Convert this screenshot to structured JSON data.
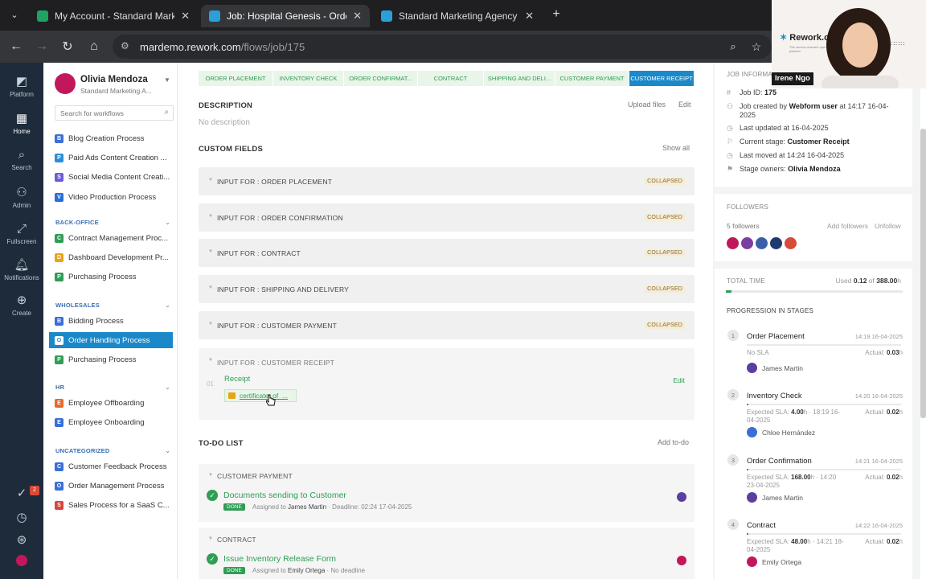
{
  "browser": {
    "tabs": [
      {
        "title": "My Account - Standard Marketi",
        "color": "#1ea362"
      },
      {
        "title": "Job: Hospital Genesis - Order H",
        "color": "#2a9fd8"
      },
      {
        "title": "Standard Marketing Agency",
        "color": "#2a9fd8"
      }
    ],
    "close_glyph": "✕",
    "new_tab_glyph": "+",
    "url_host": "mardemo.rework.com",
    "url_path": "/flows/job/175"
  },
  "rail": [
    {
      "label": "Platform",
      "icon": "platform-icon"
    },
    {
      "label": "Home",
      "icon": "home-icon"
    },
    {
      "label": "Search",
      "icon": "search-icon"
    },
    {
      "label": "Admin",
      "icon": "admin-icon"
    },
    {
      "label": "Fullscreen",
      "icon": "fullscreen-icon"
    },
    {
      "label": "Notifications",
      "icon": "bell-icon"
    },
    {
      "label": "Create",
      "icon": "plus-icon"
    }
  ],
  "rail_badge": "2",
  "sidebar": {
    "user_name": "Olivia Mendoza",
    "org_name": "Standard Marketing A...",
    "search_placeholder": "Search for workflows",
    "groups": [
      {
        "title": "",
        "items": [
          {
            "label": "Blog Creation Process",
            "color": "#3a6fd8",
            "glyph": "B"
          },
          {
            "label": "Paid Ads Content Creation ...",
            "color": "#2a8fd8",
            "glyph": "P"
          },
          {
            "label": "Social Media Content Creati...",
            "color": "#6b5dd8",
            "glyph": "S"
          },
          {
            "label": "Video Production Process",
            "color": "#2a6fd8",
            "glyph": "V"
          }
        ]
      },
      {
        "title": "BACK-OFFICE",
        "items": [
          {
            "label": "Contract Management Proc...",
            "color": "#2e9e54",
            "glyph": "C"
          },
          {
            "label": "Dashboard Development Pr...",
            "color": "#e8a317",
            "glyph": "D"
          },
          {
            "label": "Purchasing Process",
            "color": "#2e9e54",
            "glyph": "P"
          }
        ]
      },
      {
        "title": "WHOLESALES",
        "items": [
          {
            "label": "Bidding Process",
            "color": "#3a6fd8",
            "glyph": "B"
          },
          {
            "label": "Order Handling Process",
            "color": "#1b89c9",
            "glyph": "O"
          },
          {
            "label": "Purchasing Process",
            "color": "#2e9e54",
            "glyph": "P"
          }
        ]
      },
      {
        "title": "HR",
        "items": [
          {
            "label": "Employee Offboarding",
            "color": "#e86a2a",
            "glyph": "E"
          },
          {
            "label": "Employee Onboarding",
            "color": "#3a6fd8",
            "glyph": "E"
          }
        ]
      },
      {
        "title": "UNCATEGORIZED",
        "items": [
          {
            "label": "Customer Feedback Process",
            "color": "#3a6fd8",
            "glyph": "C"
          },
          {
            "label": "Order Management Process",
            "color": "#3a6fd8",
            "glyph": "O"
          },
          {
            "label": "Sales Process for a SaaS C...",
            "color": "#d8453a",
            "glyph": "S"
          }
        ]
      }
    ]
  },
  "stages": [
    {
      "label": "ORDER PLACEMENT",
      "current": false
    },
    {
      "label": "INVENTORY CHECK",
      "current": false
    },
    {
      "label": "ORDER CONFIRMAT...",
      "current": false
    },
    {
      "label": "CONTRACT",
      "current": false
    },
    {
      "label": "SHIPPING AND DELI...",
      "current": false
    },
    {
      "label": "CUSTOMER PAYMENT",
      "current": false
    },
    {
      "label": "CUSTOMER RECEIPT",
      "current": true
    }
  ],
  "description": {
    "title": "DESCRIPTION",
    "upload": "Upload files",
    "edit": "Edit",
    "empty": "No description"
  },
  "custom_fields": {
    "title": "CUSTOM FIELDS",
    "show_all": "Show all",
    "rows": [
      {
        "label": "INPUT FOR : ORDER PLACEMENT",
        "state": "COLLAPSED"
      },
      {
        "label": "INPUT FOR : ORDER CONFIRMATION",
        "state": "COLLAPSED"
      },
      {
        "label": "INPUT FOR : CONTRACT",
        "state": "COLLAPSED"
      },
      {
        "label": "INPUT FOR : SHIPPING AND DELIVERY",
        "state": "COLLAPSED"
      },
      {
        "label": "INPUT FOR : CUSTOMER PAYMENT",
        "state": "COLLAPSED"
      }
    ],
    "expanded": {
      "label": "INPUT FOR : CUSTOMER RECEIPT",
      "index": "01",
      "field": "Receipt",
      "file": "certificate_of_...",
      "edit": "Edit"
    }
  },
  "todo": {
    "title": "TO-DO LIST",
    "add": "Add to-do",
    "groups": [
      {
        "section": "CUSTOMER PAYMENT",
        "task": "Documents sending to Customer",
        "status": "DONE",
        "assigned_prefix": "Assigned to",
        "assignee": "James Martin",
        "deadline": "· Deadline: 02:24 17-04-2025"
      },
      {
        "section": "CONTRACT",
        "task": "Issue Inventory Release Form",
        "status": "DONE",
        "assigned_prefix": "Assigned to",
        "assignee": "Emily Ortega",
        "deadline": "· No deadline"
      }
    ]
  },
  "job_info": {
    "title": "JOB INFORMATI",
    "id_label": "Job ID:",
    "id": "175",
    "created_prefix": "Job created by",
    "created_by": "Webform user",
    "created_suffix": "at 14:17 16-04-",
    "created_year": "2025",
    "updated": "Last updated at 16-04-2025",
    "stage_label": "Current stage:",
    "stage": "Customer Receipt",
    "moved": "Last moved at 14:24 16-04-2025",
    "owners_label": "Stage owners:",
    "owners": "Olivia Mendoza"
  },
  "followers": {
    "title": "FOLLOWERS",
    "count": "5 followers",
    "add": "Add followers",
    "unfollow": "Unfollow",
    "avatars": [
      "#c2185b",
      "#7b3fa0",
      "#3a5fa8",
      "#1e3a6e",
      "#d84a3a"
    ]
  },
  "total_time": {
    "title": "TOTAL TIME",
    "used_label": "Used",
    "used": "0.12",
    "of": "of",
    "total": "388.00",
    "unit": "h",
    "progress_pct": 0.03
  },
  "progression": {
    "title": "PROGRESSION IN STAGES",
    "stages": [
      {
        "num": "1",
        "name": "Order Placement",
        "time": "14:19 16-04-2025",
        "sla": "No SLA",
        "sla_value": "",
        "sla_rest": "",
        "sla_line2": "",
        "actual": "0.03",
        "user": "James Martin",
        "avatar": "#5a3fa0",
        "bar": 0
      },
      {
        "num": "2",
        "name": "Inventory Check",
        "time": "14:20 16-04-2025",
        "sla": "Expected SLA:",
        "sla_value": "4.00",
        "sla_rest": "h · 18:19 16-",
        "sla_line2": "04-2025",
        "actual": "0.02",
        "user": "Chloe Hernández",
        "avatar": "#3a6fd8",
        "bar": 0.01
      },
      {
        "num": "3",
        "name": "Order Confirmation",
        "time": "14:21 16-04-2025",
        "sla": "Expected SLA:",
        "sla_value": "168.00",
        "sla_rest": "h · 14:20",
        "sla_line2": "23-04-2025",
        "actual": "0.02",
        "user": "James Martin",
        "avatar": "#5a3fa0",
        "bar": 0.01
      },
      {
        "num": "4",
        "name": "Contract",
        "time": "14:22 16-04-2025",
        "sla": "Expected SLA:",
        "sla_value": "48.00",
        "sla_rest": "h · 14:21 18-",
        "sla_line2": "04-2025",
        "actual": "0.02",
        "user": "Emily Ortega",
        "avatar": "#c2185b",
        "bar": 0.01
      }
    ],
    "actual_label": "Actual:",
    "h": "h"
  },
  "video": {
    "name": "Irene Ngo",
    "logo": "Rework.com",
    "tagline": "The service-oriented operation platform"
  },
  "colors": {
    "accent": "#1b89c9",
    "green": "#2e9e54",
    "rail": "#1d2b3a"
  }
}
